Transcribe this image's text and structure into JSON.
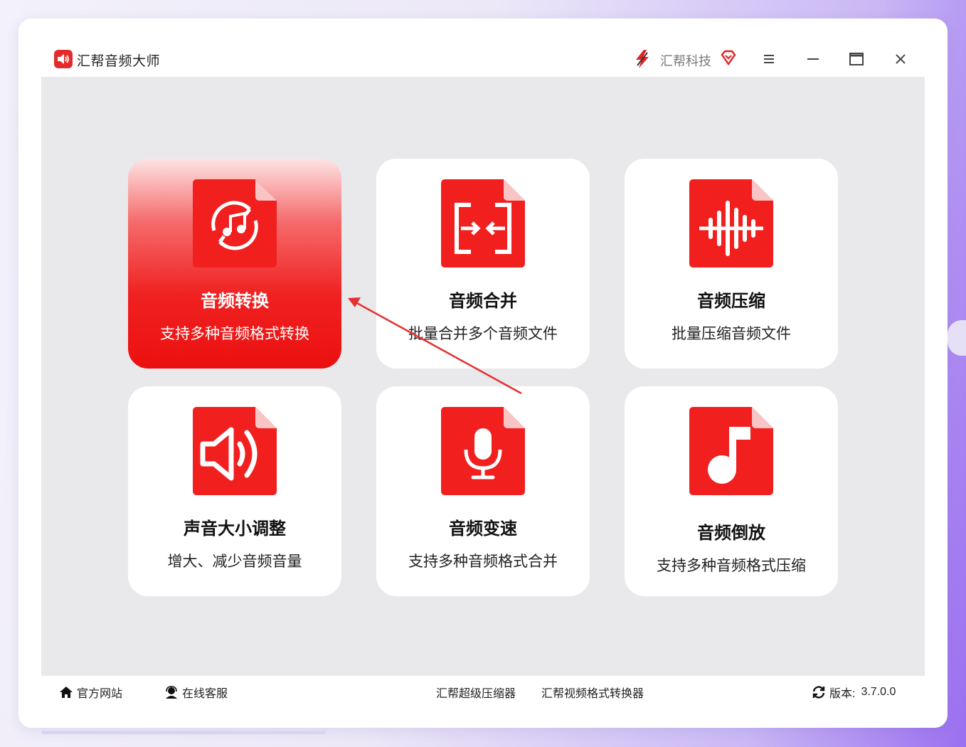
{
  "window": {
    "title": "汇帮音频大师",
    "brand": "汇帮科技"
  },
  "icons": {
    "app": "speaker-icon",
    "brand": "lightning-logo-icon",
    "vip": "diamond-vip-icon",
    "menu": "hamburger-menu-icon",
    "minimize": "minimize-icon",
    "maximize": "maximize-icon",
    "close": "close-icon"
  },
  "colors": {
    "accent": "#f02121",
    "content_bg": "#e9e9ec",
    "card_bg": "#ffffff"
  },
  "tools": [
    {
      "title": "音频转换",
      "desc": "支持多种音频格式转换",
      "icon": "audio-convert-icon",
      "selected": true
    },
    {
      "title": "音频合并",
      "desc": "批量合并多个音频文件",
      "icon": "audio-merge-icon",
      "selected": false
    },
    {
      "title": "音频压缩",
      "desc": "批量压缩音频文件",
      "icon": "audio-compress-icon",
      "selected": false
    },
    {
      "title": "声音大小调整",
      "desc": "增大、减少音频音量",
      "icon": "volume-adjust-icon",
      "selected": false
    },
    {
      "title": "音频变速",
      "desc": "支持多种音频格式合并",
      "icon": "microphone-speed-icon",
      "selected": false
    },
    {
      "title": "音频倒放",
      "desc": "支持多种音频格式压缩",
      "icon": "music-note-icon",
      "selected": false
    }
  ],
  "footer": {
    "website": "官方网站",
    "support": "在线客服",
    "link1": "汇帮超级压缩器",
    "link2": "汇帮视频格式转换器",
    "version_label": "版本:",
    "version": "3.7.0.0"
  }
}
